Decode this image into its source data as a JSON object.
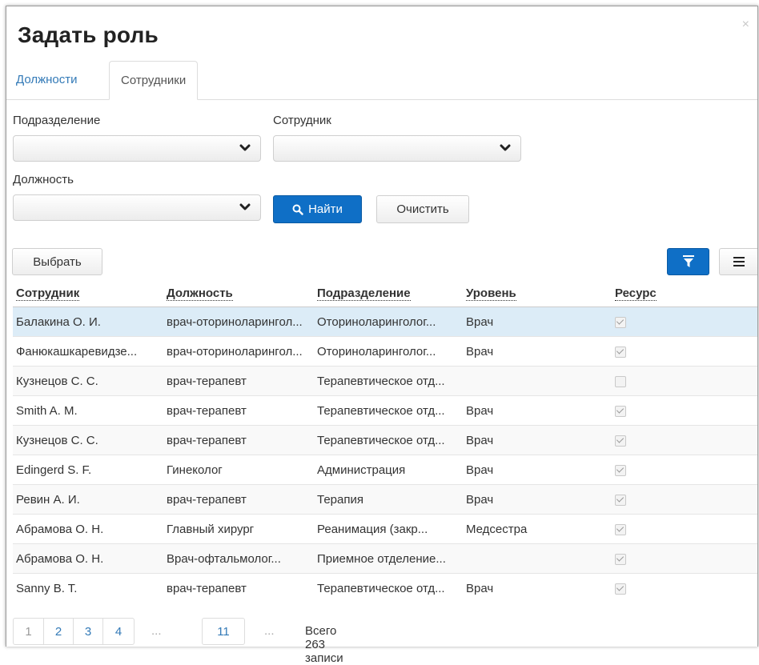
{
  "dialog": {
    "title": "Задать роль",
    "close_label": "×"
  },
  "tabs": [
    {
      "label": "Должности"
    },
    {
      "label": "Сотрудники"
    }
  ],
  "filters": {
    "department_label": "Подразделение",
    "department_value": "",
    "employee_label": "Сотрудник",
    "employee_value": "",
    "position_label": "Должность",
    "position_value": "",
    "find_label": "Найти",
    "clear_label": "Очистить"
  },
  "toolbar": {
    "select_label": "Выбрать"
  },
  "table": {
    "columns": [
      "Сотрудник",
      "Должность",
      "Подразделение",
      "Уровень",
      "Ресурс"
    ],
    "rows": [
      {
        "employee": "Балакина О. И.",
        "position": "врач-оториноларингол...",
        "department": "Оториноларинголог...",
        "level": "Врач",
        "resource": true
      },
      {
        "employee": "Фанюкашкаревидзе...",
        "position": "врач-оториноларингол...",
        "department": "Оториноларинголог...",
        "level": "Врач",
        "resource": true
      },
      {
        "employee": "Кузнецов С. С.",
        "position": "врач-терапевт",
        "department": "Терапевтическое отд...",
        "level": "",
        "resource": false
      },
      {
        "employee": "Smith A. M.",
        "position": "врач-терапевт",
        "department": "Терапевтическое отд...",
        "level": "Врач",
        "resource": true
      },
      {
        "employee": "Кузнецов С. С.",
        "position": "врач-терапевт",
        "department": "Терапевтическое отд...",
        "level": "Врач",
        "resource": true
      },
      {
        "employee": "Edingerd S. F.",
        "position": "Гинеколог",
        "department": "Администрация",
        "level": "Врач",
        "resource": true
      },
      {
        "employee": "Ревин А. И.",
        "position": "врач-терапевт",
        "department": "Терапия",
        "level": "Врач",
        "resource": true
      },
      {
        "employee": "Абрамова О. Н.",
        "position": "Главный хирург",
        "department": "Реанимация (закр...",
        "level": "Медсестра",
        "resource": true
      },
      {
        "employee": "Абрамова О. Н.",
        "position": "Врач-офтальмолог...",
        "department": "Приемное отделение...",
        "level": "",
        "resource": true
      },
      {
        "employee": "Sanny B. T.",
        "position": "врач-терапевт",
        "department": "Терапевтическое отд...",
        "level": "Врач",
        "resource": true
      }
    ]
  },
  "pagination": {
    "pages": [
      "1",
      "2",
      "3",
      "4"
    ],
    "ellipsis": "...",
    "last_page": "11",
    "total_text": "Всего 263 записи"
  },
  "colors": {
    "primary": "#0f6fc6",
    "selected_row": "#dcecf7",
    "link": "#337ab7"
  }
}
